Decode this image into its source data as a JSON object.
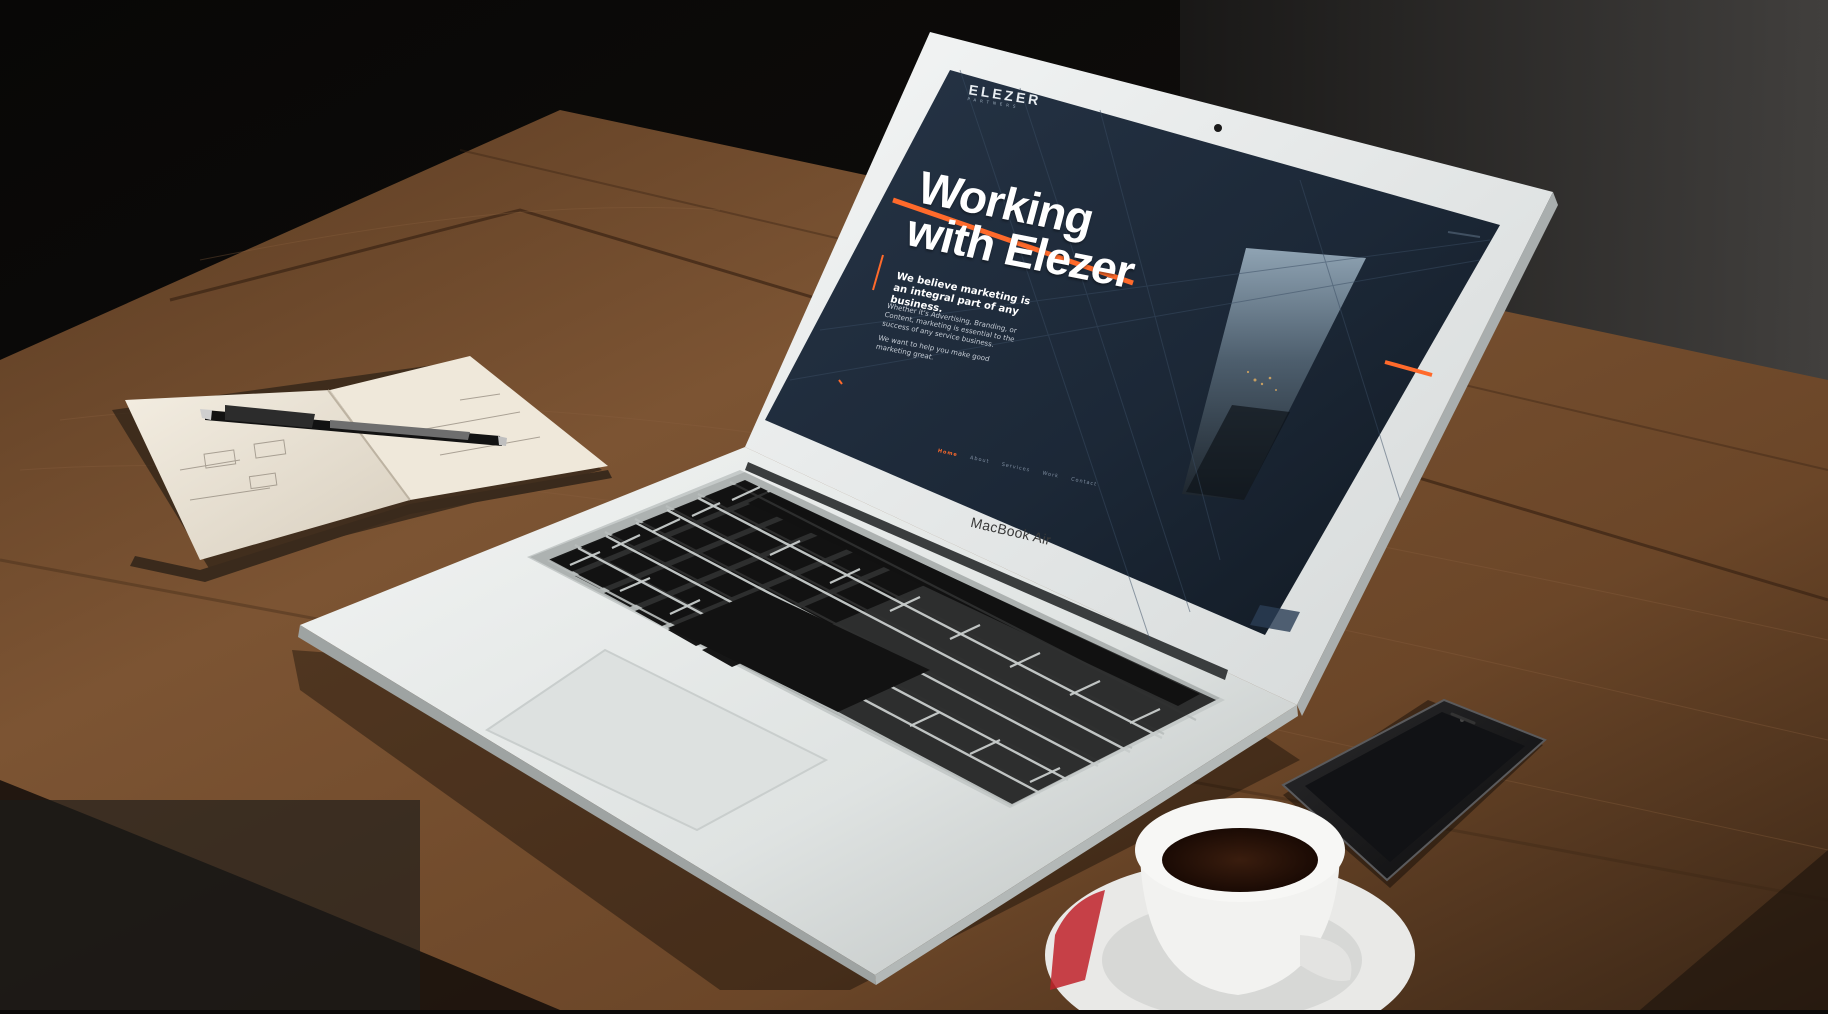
{
  "scene": {
    "description_colors": {
      "background": "#0b0908",
      "wood": "#7a5230",
      "laptop_silver": "#e8ecec",
      "screen_bg": "#1a2330",
      "accent_orange": "#ff6a2b"
    }
  },
  "laptop": {
    "brand_label": "MacBook Air"
  },
  "website": {
    "logo": {
      "main": "ELEZER",
      "sub": "PARTNERS"
    },
    "hero": {
      "title_line1": "Working",
      "title_line2": "with Elezer"
    },
    "tagline": "We believe marketing is an integral part of any business.",
    "body_paragraph_1": "Whether it's Advertising, Branding, or Content, marketing is essential to the success of any service business.",
    "body_paragraph_2": "We want to help you make good marketing great.",
    "nav": {
      "active": "Home",
      "items": [
        "About",
        "Services",
        "Work",
        "Contact"
      ]
    }
  }
}
